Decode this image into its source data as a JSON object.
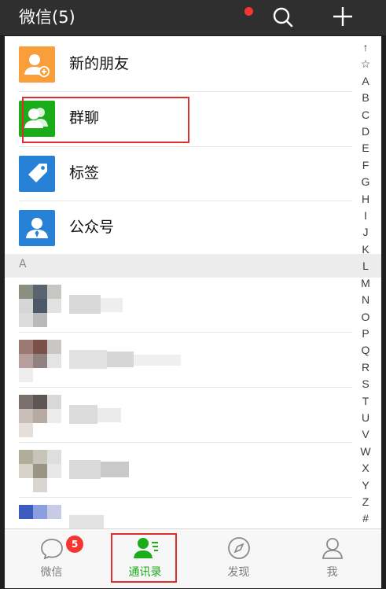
{
  "header": {
    "title": "微信(5)",
    "search_icon": "search-icon",
    "add_icon": "plus-icon"
  },
  "menu": [
    {
      "label": "新的朋友",
      "icon": "add-friend-icon",
      "color": "#fa9d3b"
    },
    {
      "label": "群聊",
      "icon": "group-chat-icon",
      "color": "#1aad19"
    },
    {
      "label": "标签",
      "icon": "tag-icon",
      "color": "#2782d7"
    },
    {
      "label": "公众号",
      "icon": "official-account-icon",
      "color": "#2782d7"
    }
  ],
  "section": {
    "letter": "A"
  },
  "index_letters": [
    "↑",
    "☆",
    "A",
    "B",
    "C",
    "D",
    "E",
    "F",
    "G",
    "H",
    "I",
    "J",
    "K",
    "L",
    "M",
    "N",
    "O",
    "P",
    "Q",
    "R",
    "S",
    "T",
    "U",
    "V",
    "W",
    "X",
    "Y",
    "Z",
    "#"
  ],
  "tabs": [
    {
      "label": "微信",
      "icon": "chat-bubble-icon",
      "badge": "5",
      "active": false
    },
    {
      "label": "通讯录",
      "icon": "contacts-icon",
      "active": true
    },
    {
      "label": "发现",
      "icon": "compass-icon",
      "active": false,
      "dot": true
    },
    {
      "label": "我",
      "icon": "person-icon",
      "active": false
    }
  ],
  "colors": {
    "accent": "#1aad19",
    "badge": "#f43530",
    "header_bg": "#2f2f2f",
    "annotation": "#e02e2e"
  }
}
